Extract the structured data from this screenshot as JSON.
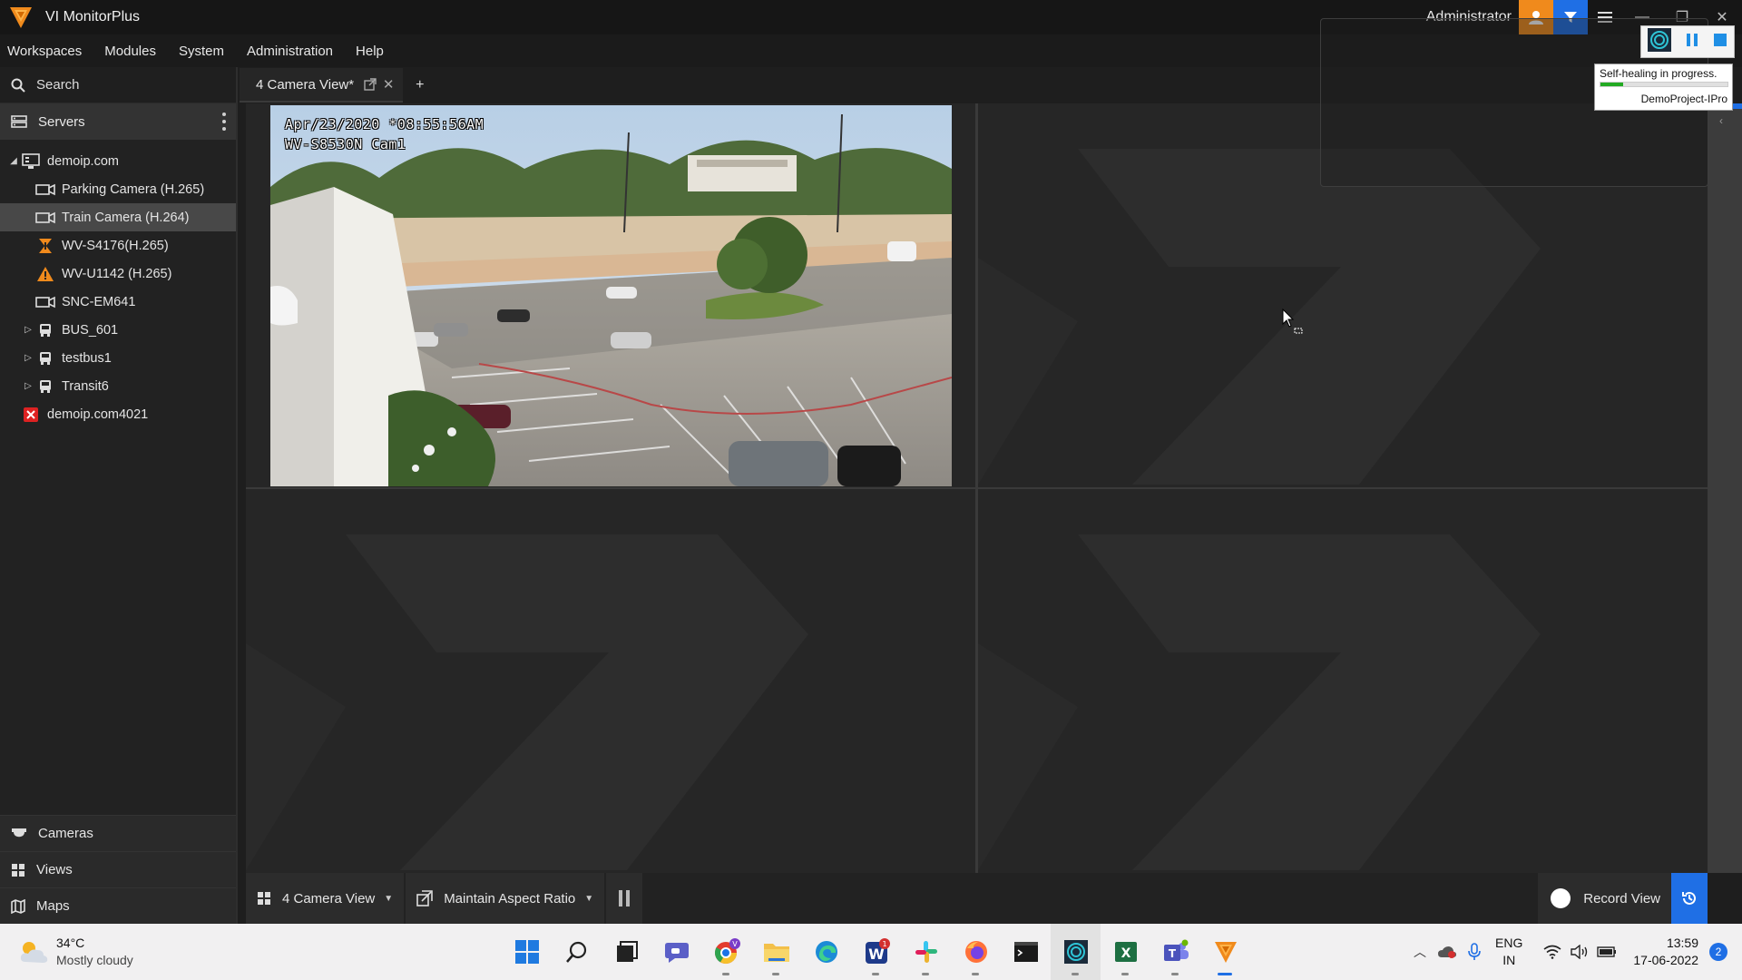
{
  "app": {
    "title": "VI MonitorPlus",
    "user": "Administrator"
  },
  "menu": [
    "Workspaces",
    "Modules",
    "System",
    "Administration",
    "Help"
  ],
  "sidebar": {
    "search_label": "Search",
    "servers_label": "Servers",
    "tree": [
      {
        "label": "demoip.com",
        "level": 0,
        "icon": "server-icon",
        "expand": "expanded"
      },
      {
        "label": "Parking Camera (H.265)",
        "level": 1,
        "icon": "camera-icon",
        "expand": "none"
      },
      {
        "label": "Train Camera (H.264)",
        "level": 1,
        "icon": "camera-icon",
        "expand": "none",
        "selected": true
      },
      {
        "label": "WV-S4176(H.265)",
        "level": 1,
        "icon": "warning-camera-icon",
        "expand": "none"
      },
      {
        "label": "WV-U1142 (H.265)",
        "level": 1,
        "icon": "warning-camera-icon",
        "expand": "none"
      },
      {
        "label": "SNC-EM641",
        "level": 1,
        "icon": "camera-icon",
        "expand": "none"
      },
      {
        "label": "BUS_601",
        "level": 1,
        "icon": "bus-icon",
        "expand": "collapsed"
      },
      {
        "label": "testbus1",
        "level": 1,
        "icon": "bus-icon",
        "expand": "collapsed"
      },
      {
        "label": "Transit6",
        "level": 1,
        "icon": "bus-icon",
        "expand": "collapsed"
      },
      {
        "label": "demoip.com4021",
        "level": 0,
        "icon": "server-error-icon",
        "expand": "none"
      }
    ],
    "bottom": [
      {
        "label": "Cameras",
        "icon": "camera-dome-icon"
      },
      {
        "label": "Views",
        "icon": "grid-icon"
      },
      {
        "label": "Maps",
        "icon": "map-icon"
      }
    ]
  },
  "tabs": [
    {
      "label": "4 Camera View*"
    }
  ],
  "video": {
    "osd_line1": "Apr/23/2020 *08:55:56AM",
    "osd_line2": "WV-S8530N Cam1"
  },
  "popup": {
    "status": "Self-healing in progress.",
    "project": "DemoProject-IPro",
    "progress": 0.18
  },
  "toolbar": {
    "view_label": "4 Camera View",
    "aspect_label": "Maintain Aspect Ratio",
    "record_label": "Record View"
  },
  "taskbar": {
    "temp": "34°C",
    "condition": "Mostly cloudy",
    "lang1": "ENG",
    "lang2": "IN",
    "time": "13:59",
    "date": "17-06-2022",
    "notifications": "2",
    "teams_badge": "1"
  },
  "colors": {
    "accent": "#1f6fe5",
    "orange": "#f08a1c",
    "panel": "#222222"
  }
}
